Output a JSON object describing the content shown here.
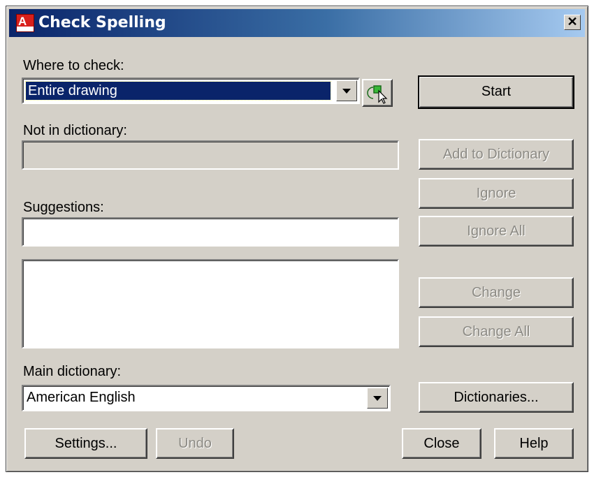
{
  "window": {
    "title": "Check Spelling",
    "close_glyph": "✕",
    "icon": "autocad-app-icon"
  },
  "where_to_check": {
    "label": "Where to check:",
    "selected": "Entire drawing",
    "select_icon": "select-objects-icon"
  },
  "not_in_dictionary": {
    "label": "Not in dictionary:",
    "value": ""
  },
  "suggestions": {
    "label": "Suggestions:",
    "value": "",
    "list": []
  },
  "main_dictionary": {
    "label": "Main dictionary:",
    "selected": "American English"
  },
  "buttons": {
    "start": "Start",
    "add_to_dictionary": "Add to Dictionary",
    "ignore": "Ignore",
    "ignore_all": "Ignore All",
    "change": "Change",
    "change_all": "Change All",
    "dictionaries": "Dictionaries...",
    "settings": "Settings...",
    "undo": "Undo",
    "close": "Close",
    "help": "Help"
  },
  "colors": {
    "face": "#d4d0c8",
    "title_start": "#0a246a",
    "title_end": "#a6caf0",
    "selection": "#0a246a",
    "disabled_text": "#8c8a84"
  }
}
